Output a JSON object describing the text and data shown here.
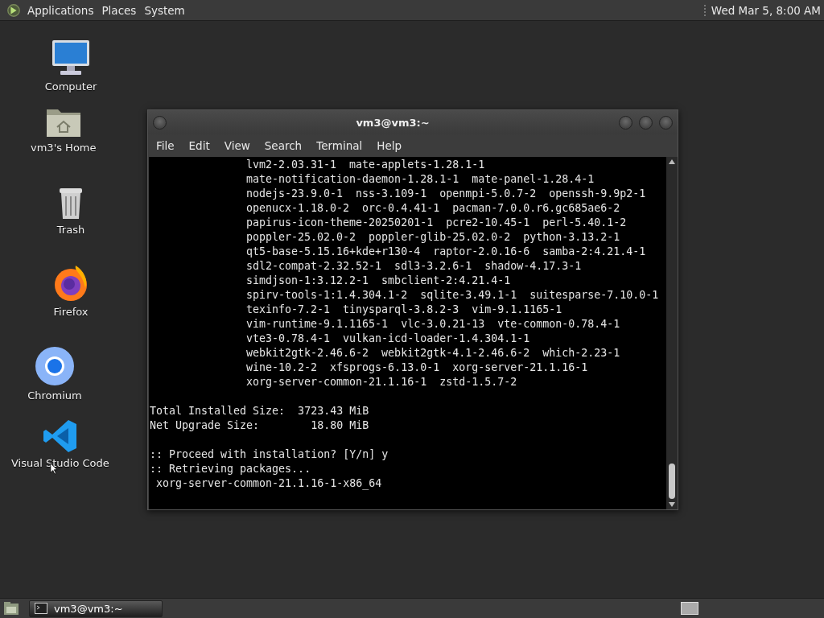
{
  "top_panel": {
    "menus": [
      "Applications",
      "Places",
      "System"
    ],
    "clock": "Wed Mar 5, 8:00 AM"
  },
  "desktop_icons": [
    {
      "kind": "computer",
      "label": "Computer"
    },
    {
      "kind": "home",
      "label": "vm3's Home"
    },
    {
      "kind": "trash",
      "label": "Trash"
    },
    {
      "kind": "firefox",
      "label": "Firefox"
    },
    {
      "kind": "chromium",
      "label": "Chromium"
    },
    {
      "kind": "vscode",
      "label": "Visual Studio Code"
    }
  ],
  "window": {
    "title": "vm3@vm3:~",
    "menu": [
      "File",
      "Edit",
      "View",
      "Search",
      "Terminal",
      "Help"
    ],
    "package_lines": [
      "lvm2-2.03.31-1  mate-applets-1.28.1-1",
      "mate-notification-daemon-1.28.1-1  mate-panel-1.28.4-1",
      "nodejs-23.9.0-1  nss-3.109-1  openmpi-5.0.7-2  openssh-9.9p2-1",
      "openucx-1.18.0-2  orc-0.4.41-1  pacman-7.0.0.r6.gc685ae6-2",
      "papirus-icon-theme-20250201-1  pcre2-10.45-1  perl-5.40.1-2",
      "poppler-25.02.0-2  poppler-glib-25.02.0-2  python-3.13.2-1",
      "qt5-base-5.15.16+kde+r130-4  raptor-2.0.16-6  samba-2:4.21.4-1",
      "sdl2-compat-2.32.52-1  sdl3-3.2.6-1  shadow-4.17.3-1",
      "simdjson-1:3.12.2-1  smbclient-2:4.21.4-1",
      "spirv-tools-1:1.4.304.1-2  sqlite-3.49.1-1  suitesparse-7.10.0-1",
      "texinfo-7.2-1  tinysparql-3.8.2-3  vim-9.1.1165-1",
      "vim-runtime-9.1.1165-1  vlc-3.0.21-13  vte-common-0.78.4-1",
      "vte3-0.78.4-1  vulkan-icd-loader-1.4.304.1-1",
      "webkit2gtk-2.46.6-2  webkit2gtk-4.1-2.46.6-2  which-2.23-1",
      "wine-10.2-2  xfsprogs-6.13.0-1  xorg-server-21.1.16-1",
      "xorg-server-common-21.1.16-1  zstd-1.5.7-2"
    ],
    "summary_lines": [
      "Total Installed Size:  3723.43 MiB",
      "Net Upgrade Size:        18.80 MiB"
    ],
    "prompt_lines": [
      ":: Proceed with installation? [Y/n] y",
      ":: Retrieving packages...",
      " xorg-server-common-21.1.16-1-x86_64"
    ]
  },
  "taskbar": {
    "tasks": [
      {
        "label": "vm3@vm3:~",
        "selected": true
      }
    ]
  }
}
